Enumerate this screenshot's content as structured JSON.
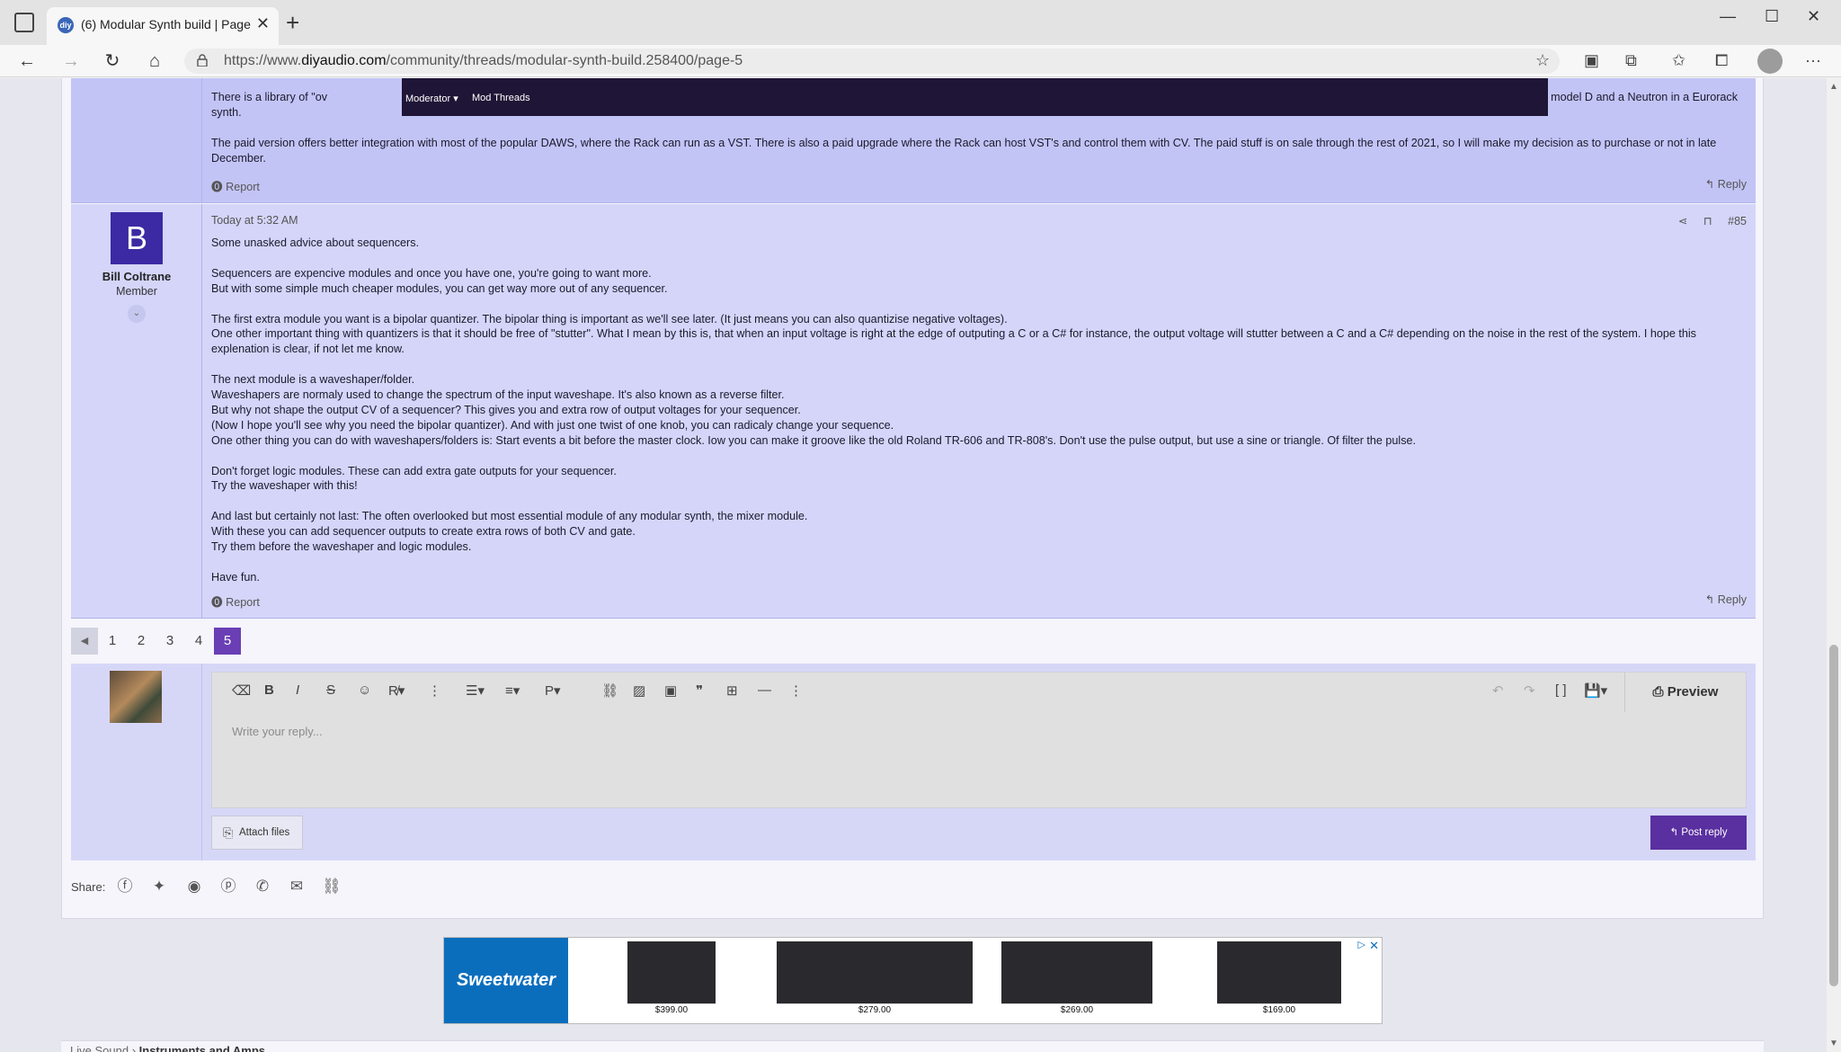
{
  "browser": {
    "tab_title": "(6) Modular Synth build | Page 5",
    "favicon_text": "diy",
    "url_prefix": "https://www.",
    "url_domain": "diyaudio.com",
    "url_path": "/community/threads/modular-synth-build.258400/page-5"
  },
  "mod_bar": {
    "moderator_label": "Moderator ▾",
    "mod_threads_label": "Mod Threads"
  },
  "post1": {
    "line1_left": "There is a library of \"ov",
    "line1_right": "ringer model D and a Neutron in a Eurorack",
    "line2": "synth.",
    "para2": "The paid version offers better integration with most of the popular DAWS, where the Rack can run as a VST. There is also a paid upgrade where the Rack can host VST's and control them with CV. The paid stuff is on sale through the rest of 2021, so I will make my decision as to purchase or not in late December.",
    "report_label": "Report",
    "reply_label": "Reply"
  },
  "post2": {
    "avatar_letter": "B",
    "user_name": "Bill Coltrane",
    "user_title": "Member",
    "date": "Today at 5:32 AM",
    "post_number": "#85",
    "paragraphs": [
      [
        "Some unasked advice about sequencers."
      ],
      [
        "Sequencers are expencive modules and once you have one, you're going to want more.",
        "But with some simple much cheaper modules, you can get way more out of any sequencer."
      ],
      [
        "The first extra module you want is a bipolar quantizer. The bipolar thing is important as we'll see later. (It just means you can also quantizise negative voltages).",
        "One other important thing with quantizers is that it should be free of \"stutter\". What I mean by this is, that when an input voltage is right at the edge of outputing a C or a C# for instance, the output voltage will stutter between a C and a C# depending on the noise in the rest of the system. I hope this explenation is clear, if not let me know."
      ],
      [
        "The next module is a waveshaper/folder.",
        "Waveshapers are normaly used to change the spectrum of the input waveshape. It's also known as a reverse filter.",
        "But why not shape the output CV of a sequencer? This gives you and extra row of output voltages for your sequencer.",
        "(Now I hope you'll see why you need the bipolar quantizer). And with just one twist of one knob, you can radicaly change your sequence.",
        "One other thing you can do with waveshapers/folders is: Start events a bit before the master clock. Iow you can make it groove like the old Roland TR-606 and TR-808's. Don't use the pulse output, but use a sine or triangle. Of filter the pulse."
      ],
      [
        "Don't forget logic modules. These can add extra gate outputs for your sequencer.",
        "Try the waveshaper with this!"
      ],
      [
        "And last but certainly not last: The often overlooked but most essential module of any modular synth, the mixer module.",
        "With these you can add sequencer outputs to create extra rows of both CV and gate.",
        "Try them before the waveshaper and logic modules."
      ],
      [
        "Have fun."
      ]
    ],
    "report_label": "Report",
    "reply_label": "Reply"
  },
  "pagination": {
    "pages": [
      "1",
      "2",
      "3",
      "4",
      "5"
    ],
    "current": "5"
  },
  "editor": {
    "placeholder": "Write your reply...",
    "preview_label": "Preview",
    "attach_label": "Attach files",
    "post_reply_label": "Post reply"
  },
  "share": {
    "label": "Share:"
  },
  "ad": {
    "brand": "Sweetwater",
    "items": [
      {
        "price": "$399.00"
      },
      {
        "price": "$279.00"
      },
      {
        "price": "$269.00"
      },
      {
        "price": "$169.00"
      }
    ]
  },
  "breadcrumb": {
    "item1": "Live Sound",
    "item2": "Instruments and Amps"
  }
}
